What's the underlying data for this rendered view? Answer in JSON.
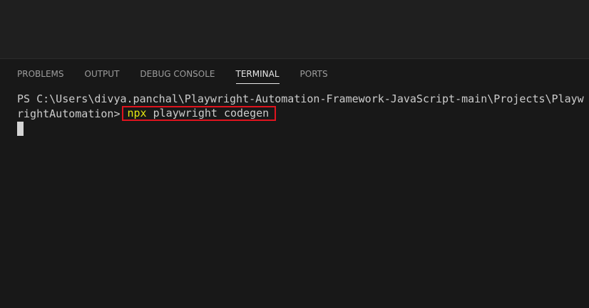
{
  "panel": {
    "tabs": [
      {
        "label": "PROBLEMS",
        "active": false
      },
      {
        "label": "OUTPUT",
        "active": false
      },
      {
        "label": "DEBUG CONSOLE",
        "active": false
      },
      {
        "label": "TERMINAL",
        "active": true
      },
      {
        "label": "PORTS",
        "active": false
      }
    ]
  },
  "terminal": {
    "prompt_line1": "PS C:\\Users\\divya.panchal\\Playwright-Automation-Framework-JavaScript-main\\Projects\\Playw",
    "prompt_line2": "rightAutomation>",
    "command": {
      "executable": "npx",
      "args": " playwright codegen"
    },
    "highlight_color": "#e0141e",
    "executable_color": "#e5e510"
  }
}
